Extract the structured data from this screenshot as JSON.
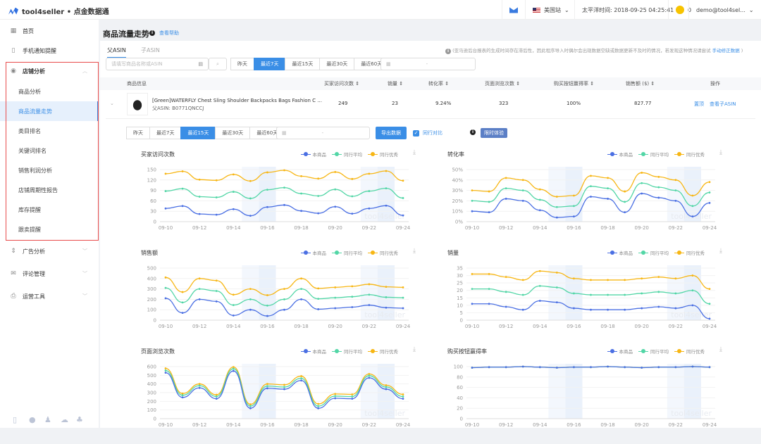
{
  "app": {
    "brand": "tool4seller • 点金数据通"
  },
  "topbar": {
    "site": "美国站",
    "time": "太平洋时间: 2018-09-25 04:25:41",
    "coins": "0",
    "user": "demo@tool4sel..."
  },
  "sidebar": {
    "items": [
      {
        "label": "首页",
        "icon": "grid-icon"
      },
      {
        "label": "手机通知提醒",
        "icon": "tablet-icon"
      },
      {
        "label": "店铺分析",
        "icon": "eye-icon"
      },
      {
        "label": "商品分析"
      },
      {
        "label": "商品流量走势"
      },
      {
        "label": "类目排名"
      },
      {
        "label": "关键词排名"
      },
      {
        "label": "销售利润分析"
      },
      {
        "label": "店铺周期性报告"
      },
      {
        "label": "库存提醒"
      },
      {
        "label": "跟卖提醒"
      },
      {
        "label": "广告分析",
        "icon": "sort-icon"
      },
      {
        "label": "评论管理",
        "icon": "mail-icon"
      },
      {
        "label": "运营工具",
        "icon": "printer-icon"
      }
    ]
  },
  "page": {
    "title": "商品流量走势",
    "help": "查看帮助",
    "tabs": [
      "父ASIN",
      "子ASIN"
    ],
    "notice": "(亚马逊后台报表的生成时间存在滞后性，因此程序导入时偶尔会出现数据空缺或数据更新不及时的情况，若发现这种情况请尝试",
    "notice_link": "手动修正数据",
    "notice_end": ")",
    "search_placeholder": "请填写商品名称或ASIN",
    "ranges": [
      "昨天",
      "最近7天",
      "最近15天",
      "最近30天",
      "最近60天"
    ],
    "date_sep": "-"
  },
  "table": {
    "headers": [
      "商品信息",
      "买家访问次数 ⇕",
      "销量 ⇕",
      "转化率 ⇕",
      "页面浏览次数 ⇕",
      "购买按钮赢得率 ⇕",
      "销售额 ($) ⇕",
      "操作"
    ],
    "row": {
      "title": "[Green]WATERFLY Chest Sling Shoulder Backpacks Bags Fashion C ...",
      "asin": "父ASIN: B0771QNCCJ",
      "visits": "249",
      "units": "23",
      "conversion": "9.24%",
      "pageviews": "323",
      "buybox": "100%",
      "sales": "827.77",
      "action1": "置顶",
      "action2": "查看子ASIN"
    }
  },
  "detail": {
    "ranges": [
      "昨天",
      "最近7天",
      "最近15天",
      "最近30天",
      "最近60天"
    ],
    "date_sep": "-",
    "export": "导出数据",
    "compare": "同行对比",
    "trial": "限时体验"
  },
  "legend": [
    "本商品",
    "同行平均",
    "同行优秀"
  ],
  "colors": {
    "self": "#4a6fe3",
    "avg": "#52d6a6",
    "top": "#f7b614",
    "accent": "#3a8ee6"
  },
  "chart_data": [
    {
      "type": "line",
      "title": "买家访问次数",
      "x": [
        "09-10",
        "09-11",
        "09-12",
        "09-13",
        "09-14",
        "09-15",
        "09-16",
        "09-17",
        "09-18",
        "09-19",
        "09-20",
        "09-21",
        "09-22",
        "09-23",
        "09-24"
      ],
      "ylim": [
        0,
        150
      ],
      "yticks": [
        "0",
        "30",
        "60",
        "90",
        "120",
        "150"
      ],
      "series": [
        {
          "name": "本商品",
          "values": [
            38,
            45,
            22,
            20,
            36,
            17,
            42,
            48,
            31,
            24,
            43,
            23,
            38,
            46,
            18
          ]
        },
        {
          "name": "同行平均",
          "values": [
            88,
            95,
            72,
            70,
            86,
            67,
            92,
            98,
            81,
            74,
            93,
            73,
            88,
            96,
            68
          ]
        },
        {
          "name": "同行优秀",
          "values": [
            138,
            145,
            121,
            119,
            136,
            117,
            142,
            148,
            131,
            124,
            143,
            123,
            138,
            146,
            118
          ]
        }
      ]
    },
    {
      "type": "line",
      "title": "转化率",
      "x": [
        "09-10",
        "09-11",
        "09-12",
        "09-13",
        "09-14",
        "09-15",
        "09-16",
        "09-17",
        "09-18",
        "09-19",
        "09-20",
        "09-21",
        "09-22",
        "09-23",
        "09-24"
      ],
      "ylim": [
        0,
        50
      ],
      "yticks": [
        "0%",
        "10%",
        "20%",
        "30%",
        "40%",
        "50%"
      ],
      "series": [
        {
          "name": "本商品",
          "values": [
            10,
            9,
            22,
            20,
            11,
            4,
            5,
            24,
            22,
            9,
            27,
            23,
            20,
            5,
            18
          ]
        },
        {
          "name": "同行平均",
          "values": [
            20,
            19,
            32,
            30,
            21,
            14,
            15,
            34,
            32,
            19,
            37,
            33,
            30,
            15,
            28
          ]
        },
        {
          "name": "同行优秀",
          "values": [
            30,
            29,
            42,
            40,
            31,
            24,
            25,
            44,
            42,
            29,
            47,
            43,
            40,
            25,
            38
          ]
        }
      ]
    },
    {
      "type": "line",
      "title": "销售额",
      "x": [
        "09-10",
        "09-11",
        "09-12",
        "09-13",
        "09-14",
        "09-15",
        "09-16",
        "09-17",
        "09-18",
        "09-19",
        "09-20",
        "09-21",
        "09-22",
        "09-23",
        "09-24"
      ],
      "ylim": [
        0,
        500
      ],
      "yticks": [
        "0",
        "100",
        "200",
        "300",
        "400",
        "500"
      ],
      "series": [
        {
          "name": "本商品",
          "values": [
            210,
            70,
            200,
            180,
            45,
            100,
            40,
            100,
            200,
            105,
            115,
            125,
            145,
            120,
            115
          ]
        },
        {
          "name": "同行平均",
          "values": [
            310,
            170,
            300,
            280,
            145,
            200,
            140,
            200,
            300,
            205,
            215,
            225,
            245,
            220,
            215
          ]
        },
        {
          "name": "同行优秀",
          "values": [
            410,
            270,
            400,
            380,
            245,
            300,
            240,
            300,
            400,
            305,
            315,
            325,
            345,
            320,
            315
          ]
        }
      ]
    },
    {
      "type": "line",
      "title": "销量",
      "x": [
        "09-10",
        "09-11",
        "09-12",
        "09-13",
        "09-14",
        "09-15",
        "09-16",
        "09-17",
        "09-18",
        "09-19",
        "09-20",
        "09-21",
        "09-22",
        "09-23",
        "09-24"
      ],
      "ylim": [
        0,
        35
      ],
      "yticks": [
        "0",
        "5",
        "10",
        "15",
        "20",
        "25",
        "30",
        "35"
      ],
      "series": [
        {
          "name": "本商品",
          "values": [
            11,
            11,
            9,
            7,
            13,
            12,
            8,
            7,
            7,
            7,
            8,
            9,
            8,
            10,
            1
          ]
        },
        {
          "name": "同行平均",
          "values": [
            21,
            21,
            19,
            17,
            23,
            22,
            18,
            17,
            17,
            17,
            18,
            19,
            18,
            20,
            11
          ]
        },
        {
          "name": "同行优秀",
          "values": [
            31,
            31,
            29,
            27,
            33,
            32,
            28,
            27,
            27,
            27,
            28,
            29,
            28,
            30,
            21
          ]
        }
      ]
    },
    {
      "type": "line",
      "title": "页面浏览次数",
      "x": [
        "09-10",
        "09-11",
        "09-12",
        "09-13",
        "09-14",
        "09-15",
        "09-16",
        "09-17",
        "09-18",
        "09-19",
        "09-20",
        "09-21",
        "09-22",
        "09-23",
        "09-24"
      ],
      "ylim": [
        0,
        600
      ],
      "yticks": [
        "0",
        "100",
        "200",
        "300",
        "400",
        "500",
        "600"
      ],
      "series": [
        {
          "name": "本商品",
          "values": [
            530,
            245,
            355,
            230,
            550,
            120,
            350,
            340,
            440,
            120,
            235,
            230,
            470,
            340,
            230
          ]
        },
        {
          "name": "同行平均",
          "values": [
            555,
            270,
            380,
            255,
            575,
            145,
            375,
            365,
            465,
            145,
            260,
            255,
            495,
            365,
            255
          ]
        },
        {
          "name": "同行优秀",
          "values": [
            580,
            290,
            400,
            275,
            595,
            165,
            400,
            390,
            490,
            170,
            285,
            280,
            515,
            385,
            280
          ]
        }
      ]
    },
    {
      "type": "line",
      "title": "购买按钮赢得率",
      "x": [
        "09-10",
        "09-11",
        "09-12",
        "09-13",
        "09-14",
        "09-15",
        "09-16",
        "09-17",
        "09-18",
        "09-19",
        "09-20",
        "09-21",
        "09-22",
        "09-23",
        "09-24"
      ],
      "ylim": [
        0,
        100
      ],
      "yticks": [
        "0",
        "20",
        "40",
        "60",
        "80",
        "100"
      ],
      "series": [
        {
          "name": "本商品",
          "values": [
            98,
            99,
            99,
            100,
            99,
            98,
            99,
            99,
            100,
            99,
            98,
            99,
            99,
            100,
            99
          ]
        },
        {
          "name": "同行平均",
          "values": [
            98,
            99,
            99,
            100,
            99,
            98,
            99,
            99,
            100,
            99,
            98,
            99,
            99,
            100,
            99
          ]
        },
        {
          "name": "同行优秀",
          "values": [
            98,
            99,
            99,
            100,
            99,
            98,
            99,
            99,
            100,
            99,
            98,
            99,
            99,
            100,
            99
          ]
        }
      ]
    }
  ]
}
